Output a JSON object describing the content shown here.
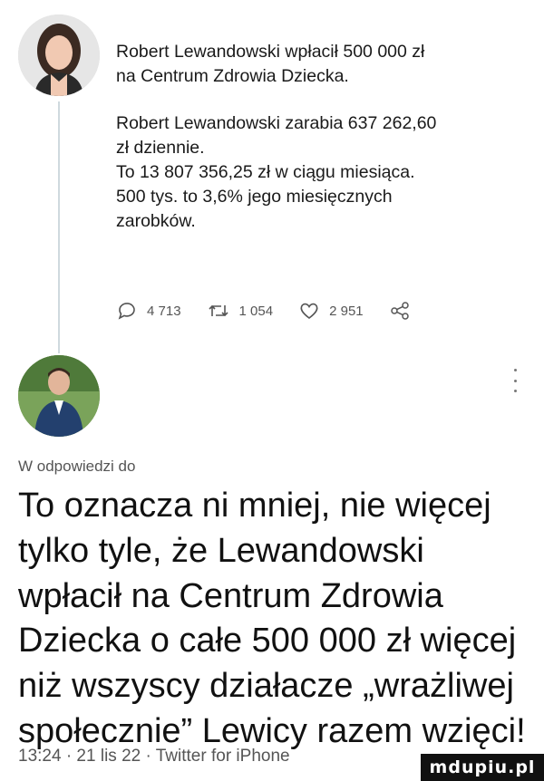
{
  "original_tweet": {
    "lines": [
      "Robert Lewandowski wpłacił 500 000 zł",
      "na Centrum Zdrowia Dziecka.",
      "",
      "Robert Lewandowski zarabia 637 262,60",
      "zł dziennie.",
      "To 13 807 356,25 zł w ciągu miesiąca.",
      "500 tys. to 3,6% jego miesięcznych",
      "zarobków."
    ],
    "replies": "4 713",
    "retweets": "1 054",
    "likes": "2 951"
  },
  "reply": {
    "context": "W odpowiedzi do",
    "lines": [
      "To oznacza ni mniej, nie więcej",
      "tylko tyle, że Lewandowski",
      "wpłacił na Centrum Zdrowia",
      "Dziecka o całe 500 000 zł więcej",
      "niż wszyscy działacze „wrażliwej",
      "społecznie” Lewicy razem wzięci!"
    ],
    "meta": "13:24 · 21 lis 22 · Twitter for iPhone"
  },
  "watermark": "mdupiu.pl",
  "icons": [
    "reply-icon",
    "retweet-icon",
    "like-icon",
    "share-icon",
    "more-icon"
  ]
}
